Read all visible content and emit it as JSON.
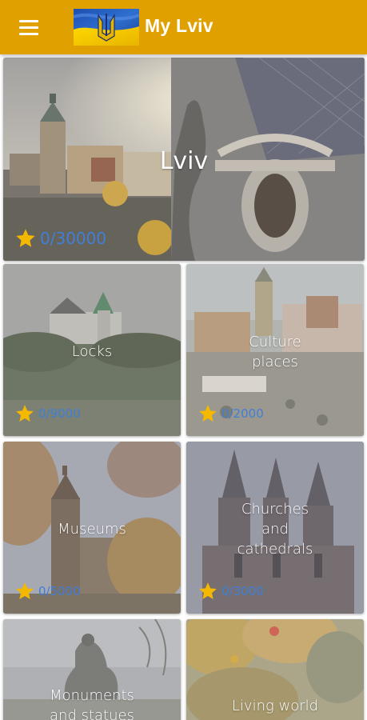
{
  "app": {
    "title": "My Lviv",
    "menu_icon": "hamburger-menu-icon",
    "logo_icon": "ukraine-flag-trident-logo",
    "accent_color": "#e0a000"
  },
  "hero": {
    "title": "Lviv",
    "progress": "0/30000"
  },
  "categories": [
    {
      "title": "Locks",
      "progress": "0/9000"
    },
    {
      "title": "Culture\nplaces",
      "progress": "0/2000"
    },
    {
      "title": "Museums",
      "progress": "0/5000"
    },
    {
      "title": "Churches\nand\ncathedrals",
      "progress": "0/3000"
    },
    {
      "title": "Monuments\nand statues"
    },
    {
      "title": "Living world"
    }
  ],
  "colors": {
    "star": "#f5b800",
    "progress_text": "#3f7fd8",
    "label": "#ffffff"
  }
}
